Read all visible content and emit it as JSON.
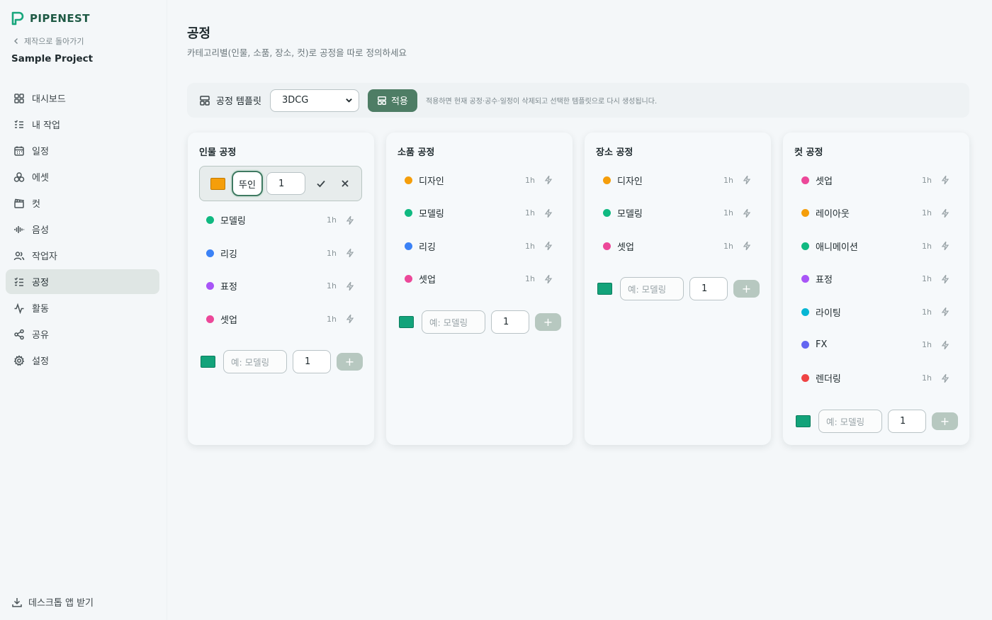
{
  "brand": {
    "name": "PIPENEST"
  },
  "sidebar": {
    "back_label": "제작으로 돌아가기",
    "project_name": "Sample Project",
    "items": [
      {
        "label": "대시보드",
        "icon": "dashboard-icon"
      },
      {
        "label": "내 작업",
        "icon": "task-list-icon"
      },
      {
        "label": "일정",
        "icon": "calendar-icon"
      },
      {
        "label": "에셋",
        "icon": "assets-icon"
      },
      {
        "label": "컷",
        "icon": "clapperboard-icon"
      },
      {
        "label": "음성",
        "icon": "audio-wave-icon"
      },
      {
        "label": "작업자",
        "icon": "users-icon"
      },
      {
        "label": "공정",
        "icon": "process-list-icon"
      },
      {
        "label": "활동",
        "icon": "activity-icon"
      },
      {
        "label": "공유",
        "icon": "share-icon"
      },
      {
        "label": "설정",
        "icon": "settings-icon"
      }
    ],
    "active_index": 7,
    "desktop_app_label": "데스크톱 앱 받기"
  },
  "page": {
    "title": "공정",
    "description": "카테고리별(인물, 소품, 장소, 컷)로 공정을 따로 정의하세요"
  },
  "template": {
    "label": "공정 템플릿",
    "selected": "3DCG",
    "apply_label": "적용",
    "note": "적용하면 현재 공정·공수·일정이 삭제되고 선택한 템플릿으로 다시 생성됩니다."
  },
  "colors": {
    "accent": "#4e7d65",
    "yellow": "#f59e0b",
    "green": "#10b981",
    "blue": "#3b82f6",
    "purple": "#a855f7",
    "pink": "#ec4899",
    "cyan": "#06b6d4",
    "indigo": "#6366f1",
    "red": "#ef4444"
  },
  "columns": [
    {
      "title": "인물 공정",
      "editing": {
        "name_value": "뚜인",
        "num_value": "1",
        "color": "#f59e0b"
      },
      "items": [
        {
          "name": "모델링",
          "dur": "1h",
          "color": "#10b981"
        },
        {
          "name": "리깅",
          "dur": "1h",
          "color": "#3b82f6"
        },
        {
          "name": "표정",
          "dur": "1h",
          "color": "#a855f7"
        },
        {
          "name": "셋업",
          "dur": "1h",
          "color": "#ec4899"
        }
      ],
      "add": {
        "placeholder": "예: 모델링",
        "num": "1",
        "plus": "+"
      }
    },
    {
      "title": "소품 공정",
      "items": [
        {
          "name": "디자인",
          "dur": "1h",
          "color": "#f59e0b"
        },
        {
          "name": "모델링",
          "dur": "1h",
          "color": "#10b981"
        },
        {
          "name": "리깅",
          "dur": "1h",
          "color": "#3b82f6"
        },
        {
          "name": "셋업",
          "dur": "1h",
          "color": "#ec4899"
        }
      ],
      "add": {
        "placeholder": "예: 모델링",
        "num": "1",
        "plus": "+"
      }
    },
    {
      "title": "장소 공정",
      "items": [
        {
          "name": "디자인",
          "dur": "1h",
          "color": "#f59e0b"
        },
        {
          "name": "모델링",
          "dur": "1h",
          "color": "#10b981"
        },
        {
          "name": "셋업",
          "dur": "1h",
          "color": "#ec4899"
        }
      ],
      "add": {
        "placeholder": "예: 모델링",
        "num": "1",
        "plus": "+"
      }
    },
    {
      "title": "컷 공정",
      "items": [
        {
          "name": "셋업",
          "dur": "1h",
          "color": "#ec4899"
        },
        {
          "name": "레이아웃",
          "dur": "1h",
          "color": "#f59e0b"
        },
        {
          "name": "애니메이션",
          "dur": "1h",
          "color": "#10b981"
        },
        {
          "name": "표정",
          "dur": "1h",
          "color": "#a855f7"
        },
        {
          "name": "라이팅",
          "dur": "1h",
          "color": "#06b6d4"
        },
        {
          "name": "FX",
          "dur": "1h",
          "color": "#6366f1"
        },
        {
          "name": "렌더링",
          "dur": "1h",
          "color": "#ef4444"
        }
      ],
      "add": {
        "placeholder": "예: 모델링",
        "num": "1",
        "plus": "+"
      }
    }
  ]
}
